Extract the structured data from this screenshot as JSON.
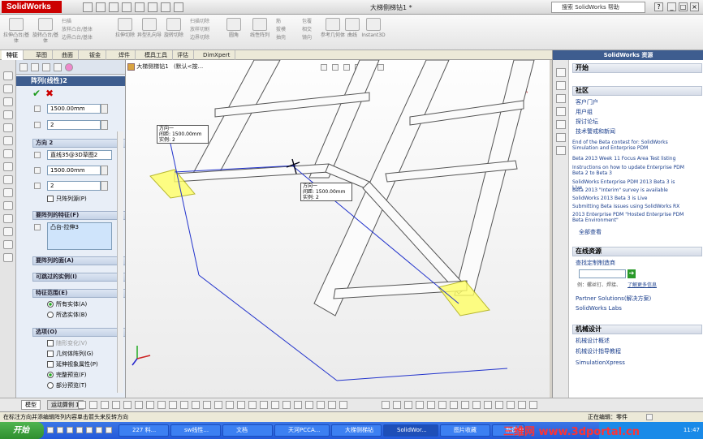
{
  "app": {
    "logo": "SolidWorks",
    "doc_title": "大梯侧梯钻1 *",
    "help_placeholder": "搜索 SolidWorks 帮助"
  },
  "ribbon": {
    "buttons": [
      "拉伸凸台/基体",
      "旋转凸台/基体",
      "扫描",
      "放样凸台/基体",
      "边界凸台/基体",
      "拉伸切除",
      "异型孔向导",
      "旋转切除",
      "扫描切除",
      "放样切割",
      "边界切除",
      "圆角",
      "线性阵列",
      "筋",
      "拔模",
      "抽壳",
      "包覆",
      "相交",
      "镜向",
      "参考几何体",
      "曲线",
      "Instant3D"
    ]
  },
  "tabs": [
    "特征",
    "草图",
    "曲面",
    "钣金",
    "焊件",
    "模具工具",
    "评估",
    "DimXpert"
  ],
  "pm": {
    "title": "阵列(线性)2",
    "dir1_spacing": "1500.00mm",
    "dir1_count": "2",
    "dir2_header": "方向 2",
    "dir2_ref": "直线35@3D草图2",
    "dir2_spacing": "1500.00mm",
    "dir2_count": "2",
    "seed_only": "只阵列源(P)",
    "features_header": "要阵列的特征(F)",
    "feature_item": "凸台-拉伸3",
    "faces_header": "要阵列的面(A)",
    "skip_header": "可跳过的实例(I)",
    "scope_header": "特征范围(E)",
    "all_bodies": "所有实体(A)",
    "selected_bodies": "所选实体(B)",
    "options_header": "选项(O)",
    "opt1": "随形变化(V)",
    "opt2": "几何体阵列(G)",
    "opt3": "延伸视象属性(P)",
    "opt4": "完整预览(F)",
    "opt5": "部分预览(T)"
  },
  "viewport": {
    "tree_label": "大梯侧梯钻1",
    "tree_sub": "(默认<按...",
    "callout1": {
      "title": "方向一",
      "l1": "间距:",
      "v1": "1500.00mm",
      "l2": "实例:",
      "v2": "2"
    },
    "callout2": {
      "title": "方向一",
      "l1": "间距:",
      "v1": "1500.00mm",
      "l2": "实例:",
      "v2": "2"
    }
  },
  "resources": {
    "title": "SolidWorks 资源",
    "start": "开始",
    "community": "社区",
    "links": [
      "客户门户",
      "用户组",
      "探讨论坛",
      "技术警戒和新闻"
    ],
    "news": [
      "End of the Beta contest for: SolidWorks Simulation and Enterprise PDM",
      "Beta 2013 Week 11 Focus Area Test listing",
      "Instructions on how to update Enterprise PDM Beta 2 to Beta 3",
      "SolidWorks Enterprise PDM 2013 Beta 3 is Live",
      "Beta 2013 \"Interim\" survey is available",
      "SolidWorks 2013 Beta 3 is Live",
      "Submitting Beta issues using SolidWorks RX",
      "2013 Enterprise PDM \"Hosted Enterprise PDM Beta Environment\""
    ],
    "all_view": "全部查看",
    "online": "在线资源",
    "find_supplier": "查找定制制造商",
    "example": "例：螺丝钉、焊接、",
    "learn_more": "了解更多信息",
    "partner": "Partner Solutions(解决方案)",
    "labs": "SolidWorks Labs",
    "mech": "机械设计",
    "mech1": "机械设计概述",
    "mech2": "机械设计指导教程",
    "simx": "SimulationXpress"
  },
  "bottom_tabs": [
    "模型",
    "运动算例 1"
  ],
  "status": {
    "left": "在标注方向并添编辑阵列内容单击箭头来反转方向",
    "editing": "正在编辑：零件"
  },
  "taskbar": {
    "start": "开始",
    "items": [
      "227 料...",
      "sw线性...",
      "文档",
      "天河PCCA...",
      "大梯侧梯钻",
      "SolidWor...",
      "图片收藏",
      "新建 Mic..."
    ],
    "clock": "11:47"
  },
  "watermark": "三维网 www.3dportal.cn"
}
